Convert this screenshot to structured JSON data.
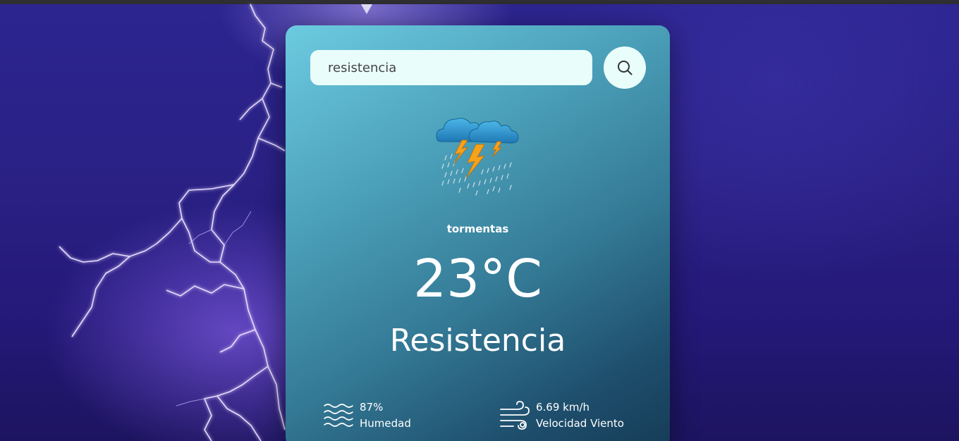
{
  "search": {
    "value": "resistencia",
    "icon": "search-icon"
  },
  "weather": {
    "icon": "thunderstorm-icon",
    "condition": "tormentas",
    "temperature": "23°C",
    "city": "Resistencia"
  },
  "details": {
    "humidity": {
      "icon": "humidity-icon",
      "value": "87%",
      "label": "Humedad"
    },
    "wind": {
      "icon": "wind-icon",
      "value": "6.69 km/h",
      "label": "Velocidad Viento"
    }
  },
  "colors": {
    "card_top": "#6ccbe0",
    "card_bottom": "#163c57",
    "input_bg": "#e9fdfb",
    "background": "#2a2185"
  }
}
